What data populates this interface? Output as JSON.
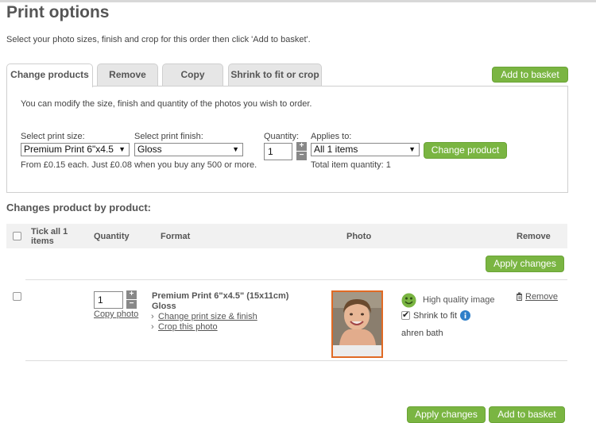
{
  "page": {
    "title": "Print options",
    "intro": "Select your photo sizes, finish and crop for this order then click 'Add to basket'."
  },
  "tabs": [
    {
      "label": "Change products"
    },
    {
      "label": "Remove"
    },
    {
      "label": "Copy"
    },
    {
      "label": "Shrink to fit or crop"
    }
  ],
  "buttons": {
    "add_to_basket": "Add to basket",
    "change_product": "Change product",
    "apply_changes": "Apply changes"
  },
  "panel": {
    "description": "You can modify the size, finish and quantity of the photos you wish to order.",
    "print_size_label": "Select print size:",
    "print_size_value": "Premium Print 6\"x4.5",
    "print_finish_label": "Select print finish:",
    "print_finish_value": "Gloss",
    "quantity_label": "Quantity:",
    "quantity_value": "1",
    "applies_to_label": "Applies to:",
    "applies_to_value": "All 1 items",
    "price_note": "From £0.15 each. Just £0.08 when you buy any 500 or more.",
    "total_quantity": "Total item quantity: 1"
  },
  "section": {
    "heading": "Changes product by product:",
    "columns": {
      "tick_all": "Tick all 1 items",
      "quantity": "Quantity",
      "format": "Format",
      "photo": "Photo",
      "remove": "Remove"
    }
  },
  "item": {
    "quantity": "1",
    "copy_photo": "Copy photo",
    "format_name": "Premium Print 6\"x4.5\" (15x11cm)",
    "finish": "Gloss",
    "change_link": "Change print size & finish",
    "crop_link": "Crop this photo",
    "quality": "High quality image",
    "shrink_label": "Shrink to fit",
    "shrink_checked": true,
    "filename": "ahren bath",
    "remove": "Remove"
  },
  "colors": {
    "accent_green": "#7ab542",
    "photo_border": "#e06a24",
    "smiley": "#7ab542",
    "info_icon": "#2f7fc9"
  }
}
